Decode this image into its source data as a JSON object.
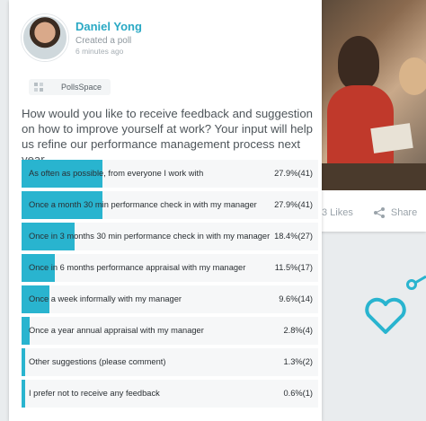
{
  "post": {
    "author": "Daniel Yong",
    "action": "Created a poll",
    "time": "6 minutes ago",
    "tag": "PollsSpace",
    "question": "How would you like to receive feedback and suggestion on how to improve yourself at work? Your input will help us refine our performance management process next year.",
    "options": [
      {
        "label": "As often as possible, from everyone I work with",
        "result": "27.9%(41)",
        "percent": 27.9
      },
      {
        "label": "Once a month 30 min performance check in with my manager",
        "result": "27.9%(41)",
        "percent": 27.9
      },
      {
        "label": "Once in 3 months 30 min performance check in with my manager",
        "result": "18.4%(27)",
        "percent": 18.4
      },
      {
        "label": "Once in 6 months performance appraisal with my manager",
        "result": "11.5%(17)",
        "percent": 11.5
      },
      {
        "label": "Once a week informally with my manager",
        "result": "9.6%(14)",
        "percent": 9.6
      },
      {
        "label": "Once a year annual appraisal with my manager",
        "result": "2.8%(4)",
        "percent": 2.8
      },
      {
        "label": "Other suggestions (please comment)",
        "result": "1.3%(2)",
        "percent": 1.3
      },
      {
        "label": "I prefer not to receive any feedback",
        "result": "0.6%(1)",
        "percent": 0.6
      }
    ]
  },
  "background_post": {
    "likes": "3 Likes",
    "share": "Share"
  },
  "colors": {
    "accent": "#29b4cf",
    "name": "#2aa9c4"
  }
}
